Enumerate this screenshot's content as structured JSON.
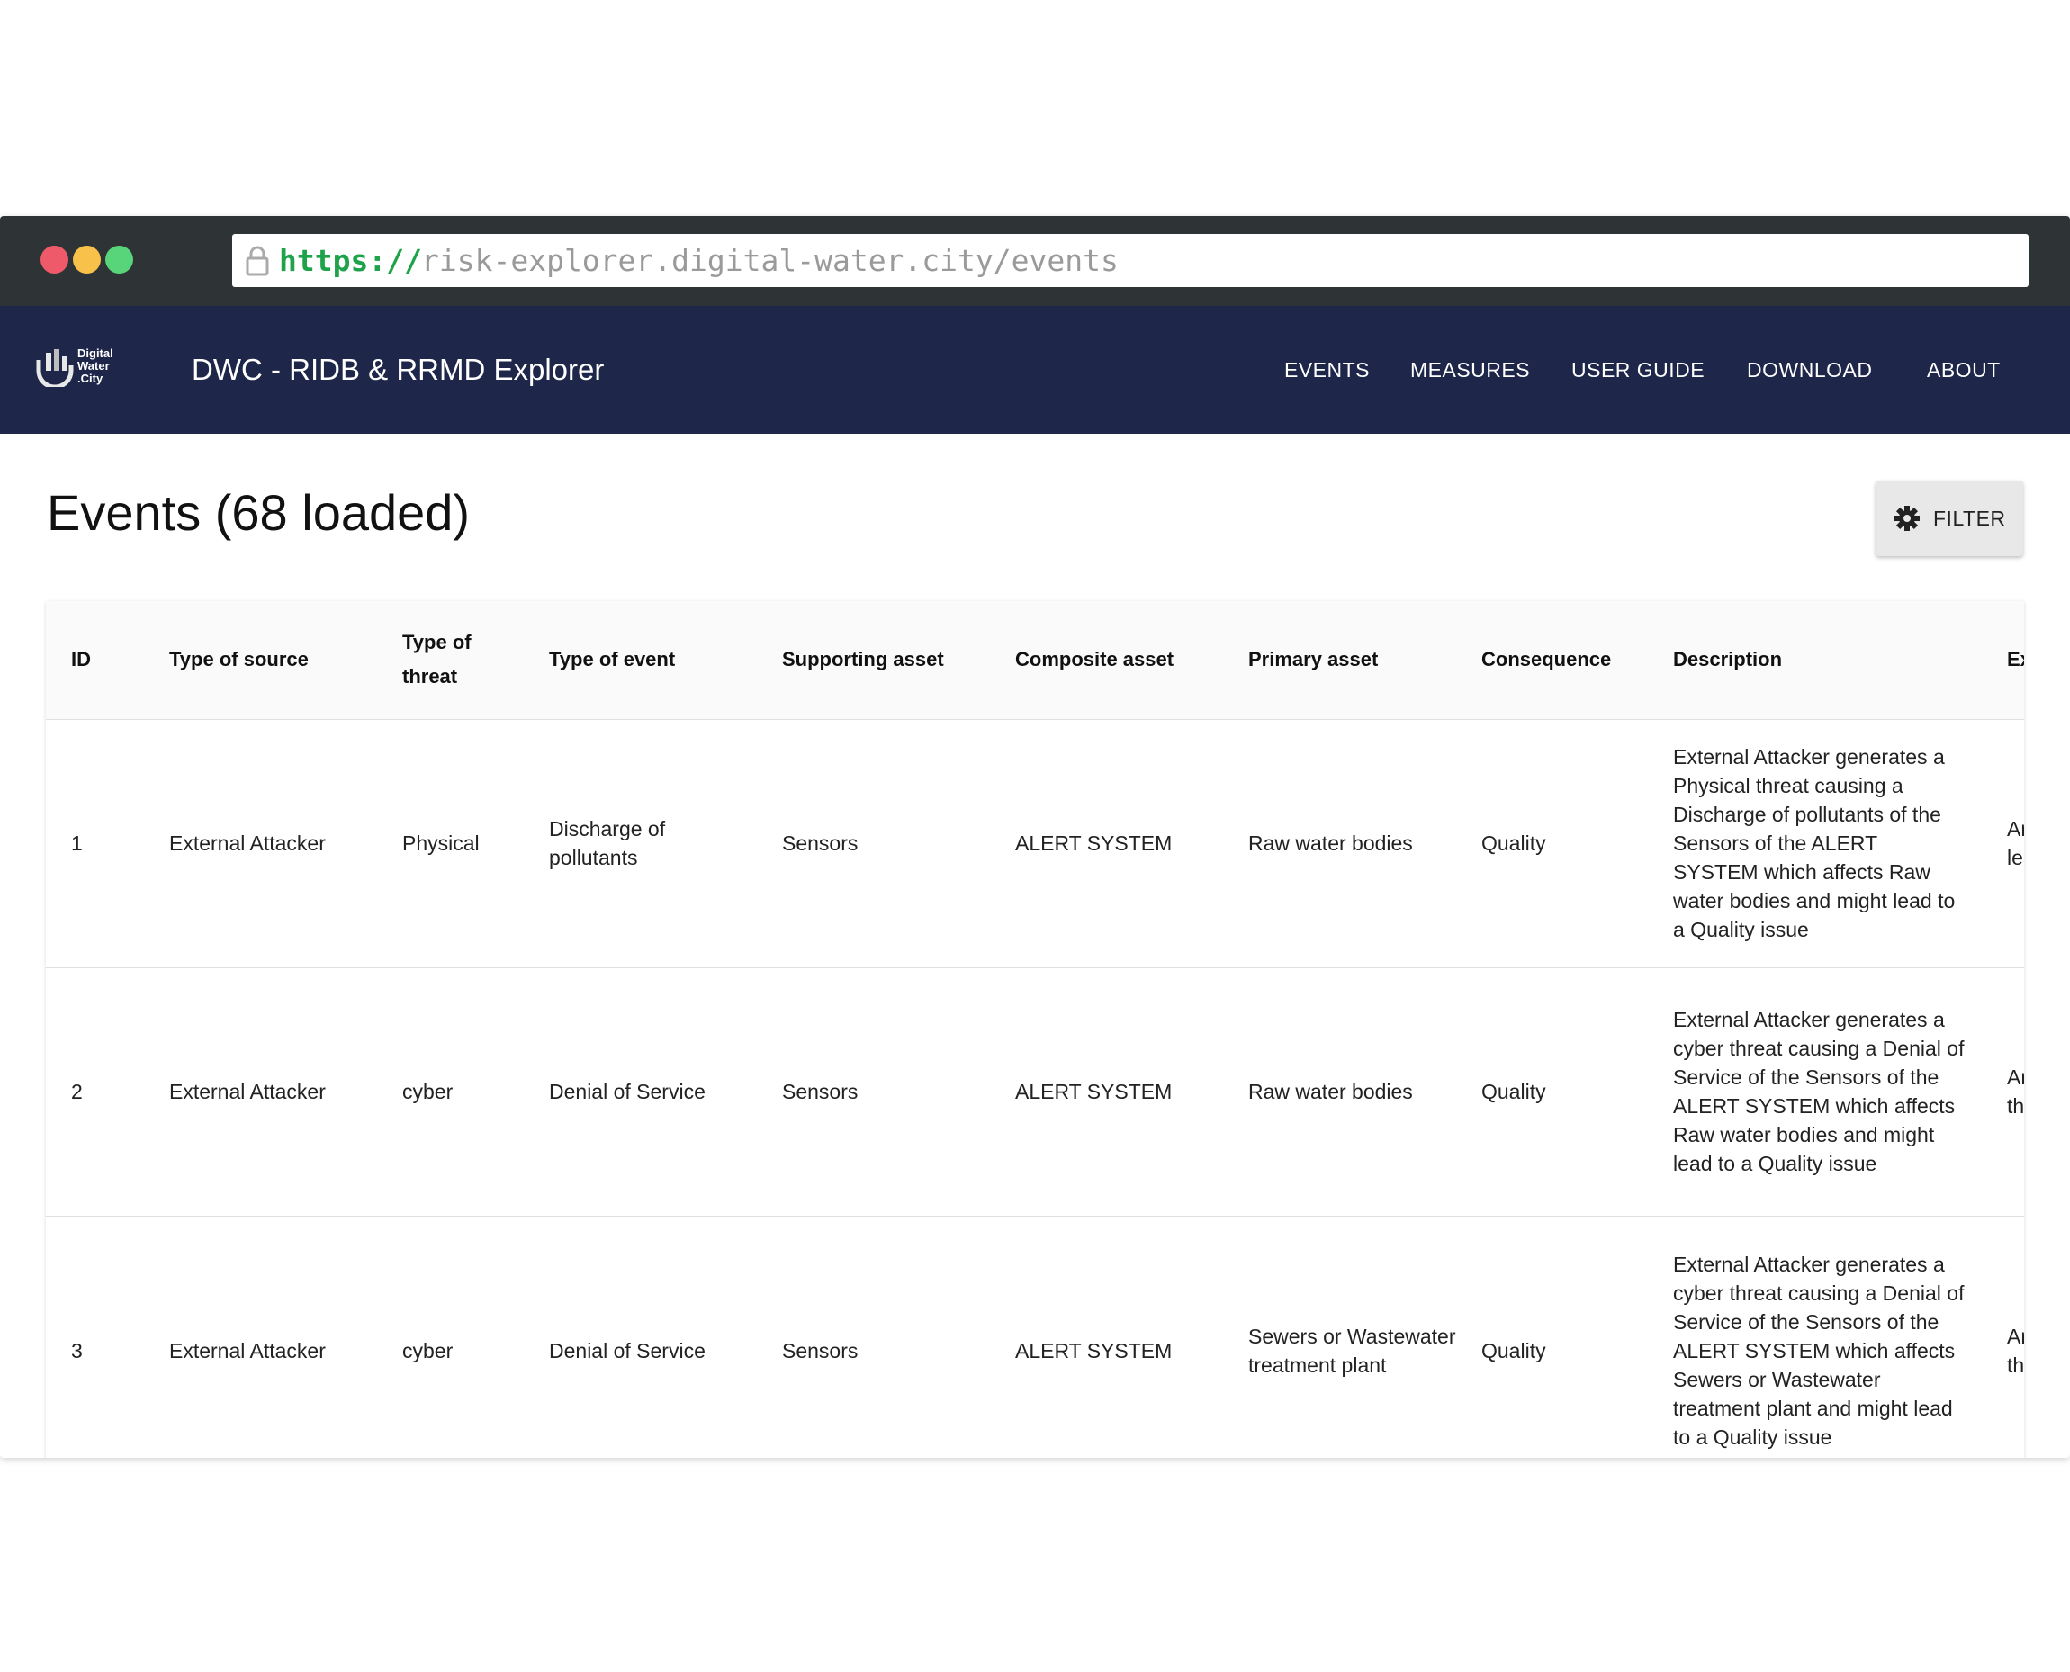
{
  "browser": {
    "url_scheme": "https://",
    "url_rest": "risk-explorer.digital-water.city/events"
  },
  "app": {
    "logo_text": "Digital\nWater\n.City",
    "title": "DWC - RIDB & RRMD Explorer",
    "nav": [
      "EVENTS",
      "MEASURES",
      "USER GUIDE",
      "DOWNLOAD",
      "ABOUT"
    ]
  },
  "page": {
    "title": "Events (68 loaded)",
    "filter_label": "FILTER"
  },
  "table": {
    "columns": [
      "ID",
      "Type of source",
      "Type of threat",
      "Type of event",
      "Supporting asset",
      "Composite asset",
      "Primary asset",
      "Consequence",
      "Description",
      "Exar"
    ],
    "rows": [
      {
        "id": "1",
        "source": "External Attacker",
        "threat": "Physical",
        "event": "Discharge of pollutants",
        "supporting": "Sensors",
        "composite": "ALERT SYSTEM",
        "primary": "Raw water bodies",
        "consequence": "Quality",
        "description": "External Attacker generates a Physical threat causing a Discharge of pollutants of the Sensors of the ALERT SYSTEM which affects Raw water bodies and might lead to a Quality issue",
        "example": "An a pollu trick into leadi the b"
      },
      {
        "id": "2",
        "source": "External Attacker",
        "threat": "cyber",
        "event": "Denial of Service",
        "supporting": "Sensors",
        "composite": "ALERT SYSTEM",
        "primary": "Raw water bodies",
        "consequence": "Quality",
        "description": "External Attacker generates a cyber threat causing a Denial of Service of the Sensors of the ALERT SYSTEM which affects Raw water bodies and might lead to a Quality issue",
        "example": "An a wher sens close then"
      },
      {
        "id": "3",
        "source": "External Attacker",
        "threat": "cyber",
        "event": "Denial of Service",
        "supporting": "Sensors",
        "composite": "ALERT SYSTEM",
        "primary": "Sewers or Wastewater treatment plant",
        "consequence": "Quality",
        "description": "External Attacker generates a cyber threat causing a Denial of Service of the Sensors of the ALERT SYSTEM which affects Sewers or Wastewater treatment plant and might lead to a Quality issue",
        "example": "An a wher sens close then"
      }
    ]
  },
  "colors": {
    "chrome": "#2e3436",
    "navbar": "#1e2749",
    "url_scheme": "#1ea34a",
    "dot_red": "#ee5a6a",
    "dot_yellow": "#f8c14a",
    "dot_green": "#58d47a"
  },
  "icons": [
    "lock-icon",
    "water-drop-logo-icon",
    "gear-icon"
  ]
}
